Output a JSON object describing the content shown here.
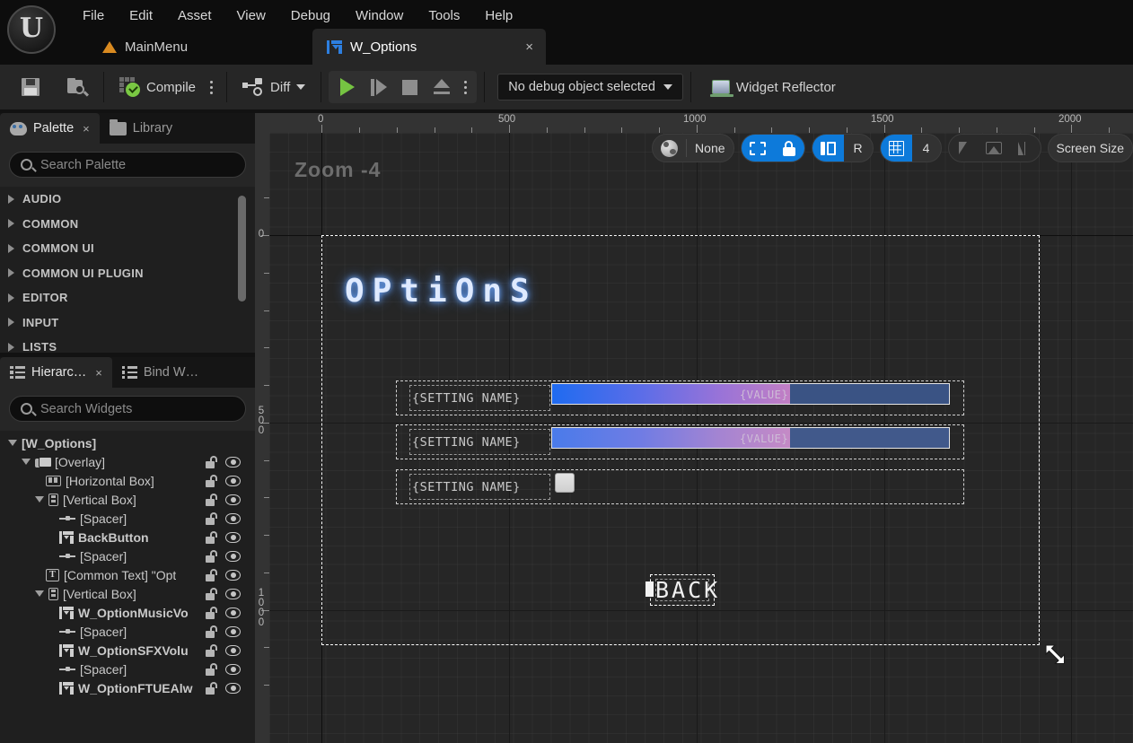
{
  "app": {
    "logo_glyph": "U",
    "menus": [
      "File",
      "Edit",
      "Asset",
      "View",
      "Debug",
      "Window",
      "Tools",
      "Help"
    ]
  },
  "tabs": {
    "mainmenu_label": "MainMenu",
    "active_label": "W_Options",
    "close_glyph": "×"
  },
  "toolbar": {
    "compile_label": "Compile",
    "diff_label": "Diff",
    "debug_object_label": "No debug object selected",
    "debug_chevron": "⌄",
    "widget_reflector_label": "Widget Reflector"
  },
  "palette": {
    "tab_label": "Palette",
    "tab_close": "×",
    "library_tab_label": "Library",
    "search_placeholder": "Search Palette",
    "search_value": "",
    "categories": [
      "AUDIO",
      "COMMON",
      "COMMON UI",
      "COMMON UI PLUGIN",
      "EDITOR",
      "INPUT",
      "LISTS"
    ]
  },
  "hierarchy": {
    "tab_label": "Hierarc…",
    "tab_close": "×",
    "bind_tab_label": "Bind W…",
    "search_placeholder": "Search Widgets",
    "search_value": "",
    "rows": [
      {
        "label": "[W_Options]",
        "indent": 0,
        "icon": "none",
        "expander": "down",
        "bold": true,
        "tools": false
      },
      {
        "label": "[Overlay]",
        "indent": 1,
        "icon": "overlay",
        "expander": "down",
        "bold": false,
        "tools": true
      },
      {
        "label": "[Horizontal Box]",
        "indent": 2,
        "icon": "hbox",
        "expander": "none",
        "bold": false,
        "tools": true
      },
      {
        "label": "[Vertical Box]",
        "indent": 2,
        "icon": "vbox",
        "expander": "down",
        "bold": false,
        "tools": true
      },
      {
        "label": "[Spacer]",
        "indent": 3,
        "icon": "spacer",
        "expander": "none",
        "bold": false,
        "tools": true
      },
      {
        "label": "BackButton",
        "indent": 3,
        "icon": "wbp",
        "expander": "none",
        "bold": true,
        "tools": true
      },
      {
        "label": "[Spacer]",
        "indent": 3,
        "icon": "spacer",
        "expander": "none",
        "bold": false,
        "tools": true
      },
      {
        "label": "[Common Text] \"Opt",
        "indent": 2,
        "icon": "text",
        "expander": "none",
        "bold": false,
        "tools": true
      },
      {
        "label": "[Vertical Box]",
        "indent": 2,
        "icon": "vbox",
        "expander": "down",
        "bold": false,
        "tools": true
      },
      {
        "label": "W_OptionMusicVo",
        "indent": 3,
        "icon": "wbp",
        "expander": "none",
        "bold": true,
        "tools": true
      },
      {
        "label": "[Spacer]",
        "indent": 3,
        "icon": "spacer",
        "expander": "none",
        "bold": false,
        "tools": true
      },
      {
        "label": "W_OptionSFXVolu",
        "indent": 3,
        "icon": "wbp",
        "expander": "none",
        "bold": true,
        "tools": true
      },
      {
        "label": "[Spacer]",
        "indent": 3,
        "icon": "spacer",
        "expander": "none",
        "bold": false,
        "tools": true
      },
      {
        "label": "W_OptionFTUEAlw",
        "indent": 3,
        "icon": "wbp",
        "expander": "none",
        "bold": true,
        "tools": true
      }
    ]
  },
  "canvas": {
    "zoom_label": "Zoom -4",
    "ruler_h_labels": [
      "0",
      "500",
      "1000",
      "1500",
      "2000"
    ],
    "ruler_v_labels": [
      "0",
      "500",
      "1000"
    ],
    "toolbar": {
      "none_label": "None",
      "rotation_label": "R",
      "grid_snap_value": "4",
      "screen_size_label": "Screen Size"
    },
    "widgets": {
      "title_text": "OPtiOnS",
      "setting_rows": [
        {
          "name": "{SETTING NAME}",
          "value": "{VALUE}",
          "control": "slider",
          "fill_pct": 60
        },
        {
          "name": "{SETTING NAME}",
          "value": "{VALUE}",
          "control": "slider",
          "fill_pct": 60
        },
        {
          "name": "{SETTING NAME}",
          "value": "",
          "control": "checkbox",
          "fill_pct": 0
        }
      ],
      "back_button_text": "BACK"
    },
    "colors": {
      "accent_blue": "#0d7ada",
      "gradient_start": "#1f6bf0",
      "gradient_mid": "#c27fc4",
      "gradient_rest": "#3a5384",
      "title_glow": "#6ea8ff"
    }
  }
}
